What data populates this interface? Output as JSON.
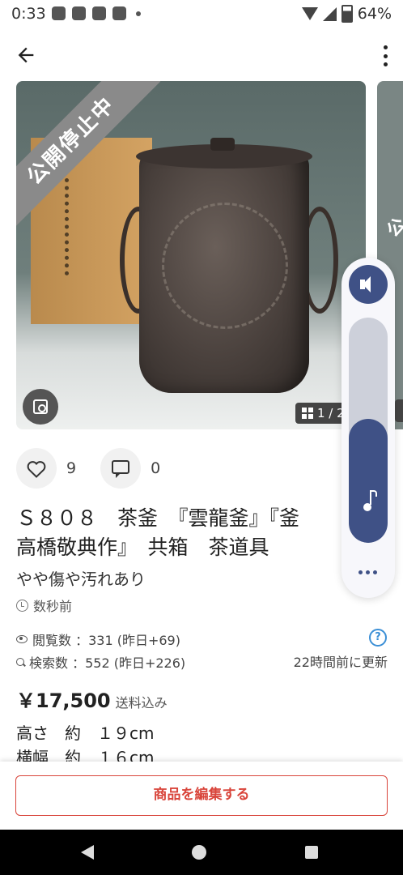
{
  "status_bar": {
    "time": "0:33",
    "battery": "64%"
  },
  "photo": {
    "ribbon": "公開停止中",
    "counter": "1 / 2",
    "next_ribbon": "公"
  },
  "social": {
    "likes": "9",
    "comments": "0"
  },
  "item": {
    "title": "Ｓ８０８　茶釜　『雲龍釜』『釜\n高橋敬典作』　共箱　茶道具",
    "condition": "やや傷や汚れあり",
    "posted": "数秒前",
    "views": "閲覧数 ：331 (昨日+69)",
    "searches": "検索数 ：552 (昨日+226)",
    "updated": "22時間前に更新",
    "price": "￥17,500",
    "shipping": "送料込み",
    "description": "高さ　約　１９cm\n横幅　約　１６cm"
  },
  "actions": {
    "edit": "商品を編集する"
  },
  "volume_panel": {
    "level": 0.55
  }
}
